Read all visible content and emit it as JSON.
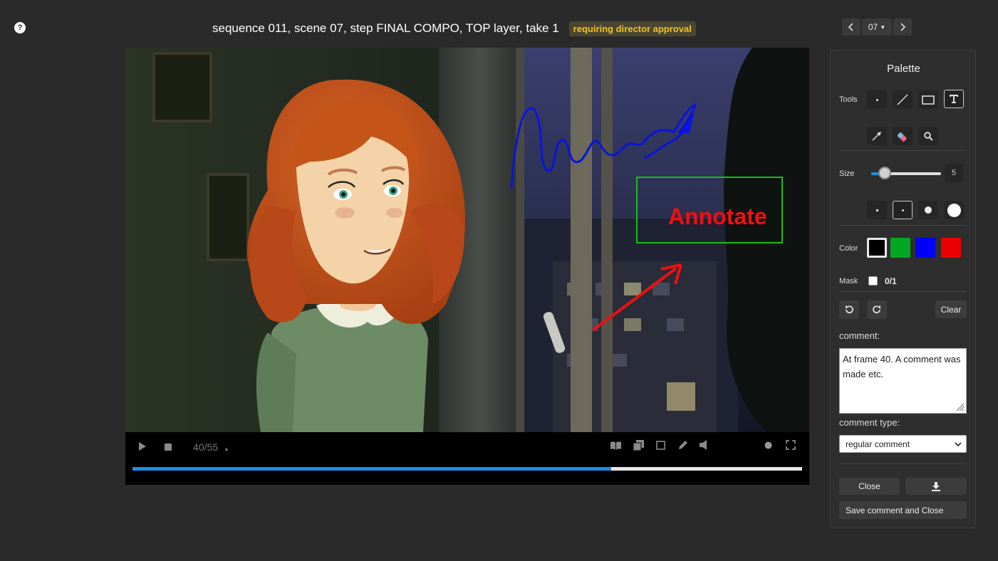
{
  "header": {
    "title": "sequence 011, scene 07, step FINAL COMPO, TOP layer, take 1",
    "status_badge": "requiring director approval",
    "help_glyph": "?"
  },
  "take_nav": {
    "selected_take": "07",
    "prev_icon": "chevron-left-icon",
    "next_icon": "chevron-right-icon"
  },
  "viewer": {
    "annotation_text": "Annotate",
    "annotation_colors": {
      "pen": "#0a14dc",
      "rect": "#18c018",
      "text": "#ee1010",
      "arrow": "#ee1010"
    }
  },
  "player": {
    "frame_counter": "40/55",
    "current_frame": 40,
    "total_frames": 55,
    "progress_fraction": 0.715,
    "progress_color": "#1d8ee0"
  },
  "palette": {
    "title": "Palette",
    "tools_label": "Tools",
    "size_label": "Size",
    "size_value": "5",
    "size_fraction": 0.13,
    "color_label": "Color",
    "colors": [
      "#000000",
      "#00a822",
      "#0000ff",
      "#ee0000"
    ],
    "selected_color": "#000000",
    "mask_label": "Mask",
    "mask_value": "0/1",
    "clear_label": "Clear",
    "comment_label": "comment:",
    "comment_text": "At frame 40. A comment was made etc.",
    "comment_type_label": "comment type:",
    "comment_type_value": "regular comment",
    "close_label": "Close",
    "save_label": "Save comment and Close"
  }
}
